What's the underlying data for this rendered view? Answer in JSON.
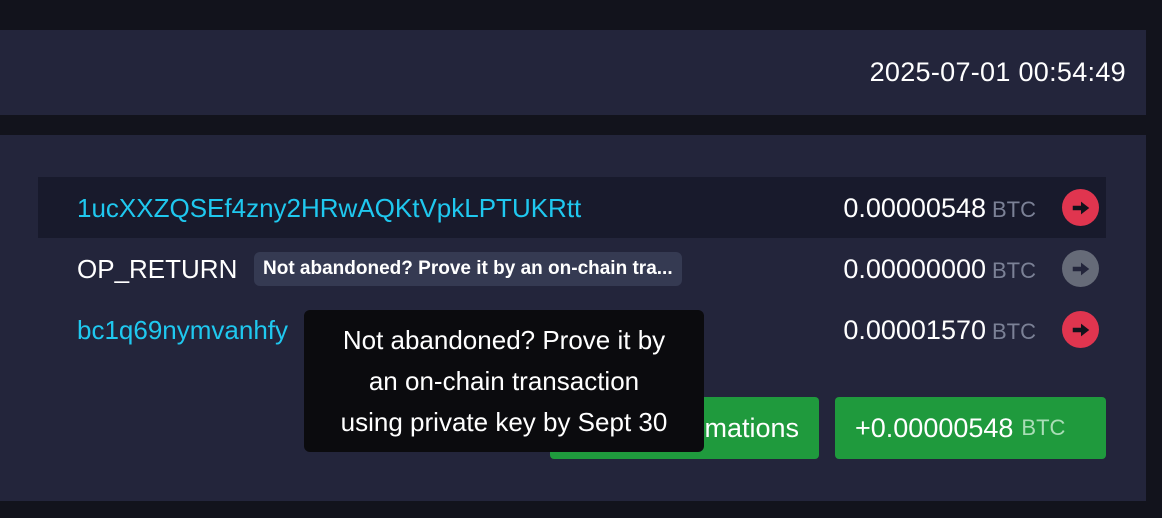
{
  "header": {
    "timestamp": "2025-07-01 00:54:49"
  },
  "outputs": [
    {
      "address": "1ucXXZQSEf4zny2HRwAQKtVpkLPTUKRtt",
      "amount": "0.00000548",
      "unit": "BTC",
      "arrow_icon": "arrow-right-icon",
      "arrow_color": "#e0354f"
    },
    {
      "address": "OP_RETURN",
      "badge": "Not abandoned? Prove it by an on-chain tra...",
      "amount": "0.00000000",
      "unit": "BTC",
      "arrow_icon": "arrow-right-icon",
      "arrow_color": "#666b78"
    },
    {
      "address": "bc1q69nymvanhfy",
      "amount": "0.00001570",
      "unit": "BTC",
      "arrow_icon": "arrow-right-icon",
      "arrow_color": "#e0354f"
    }
  ],
  "footer": {
    "confirmations_label": "mations",
    "total_amount": "+0.00000548",
    "total_unit": "BTC"
  },
  "tooltip": {
    "line1": "Not abandoned? Prove it by",
    "line2": "an on-chain transaction",
    "line3": "using private key by Sept 30"
  },
  "colors": {
    "link": "#1fc8ef",
    "panel": "#23253b",
    "accent_green": "#1f9a3d",
    "accent_red": "#e0354f"
  }
}
